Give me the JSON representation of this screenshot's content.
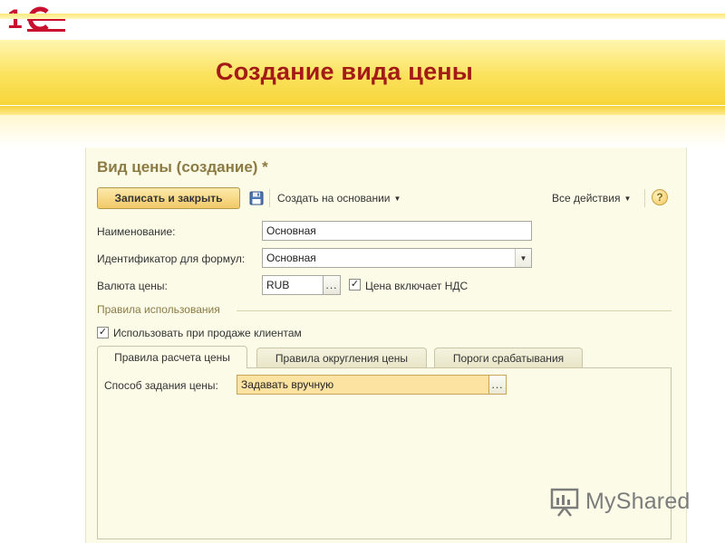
{
  "slide": {
    "logo_text": "1С",
    "title": "Создание вида цены",
    "brand_color": "#c8102e",
    "title_color": "#a31a16"
  },
  "form": {
    "title": "Вид цены (создание) *",
    "toolbar": {
      "save_close_label": "Записать и закрыть",
      "save_icon": "floppy-disk-icon",
      "create_basis_label": "Создать на основании",
      "all_actions_label": "Все действия",
      "help_label": "?"
    },
    "fields": {
      "name_label": "Наименование:",
      "name_value": "Основная",
      "formula_id_label": "Идентификатор для формул:",
      "formula_id_value": "Основная",
      "currency_label": "Валюта цены:",
      "currency_value": "RUB",
      "currency_select": "...",
      "vat_included_label": "Цена включает НДС",
      "vat_included_checked": true
    },
    "usage": {
      "group_title": "Правила использования",
      "use_for_sales_label": "Использовать при продаже клиентам",
      "use_for_sales_checked": true
    },
    "tabs": [
      {
        "label": "Правила расчета цены",
        "active": true
      },
      {
        "label": "Правила округления цены",
        "active": false
      },
      {
        "label": "Пороги срабатывания",
        "active": false
      }
    ],
    "calc_rules": {
      "method_label": "Способ задания цены:",
      "method_value": "Задавать вручную",
      "method_select": "..."
    }
  },
  "watermark": {
    "text": "MyShared"
  }
}
